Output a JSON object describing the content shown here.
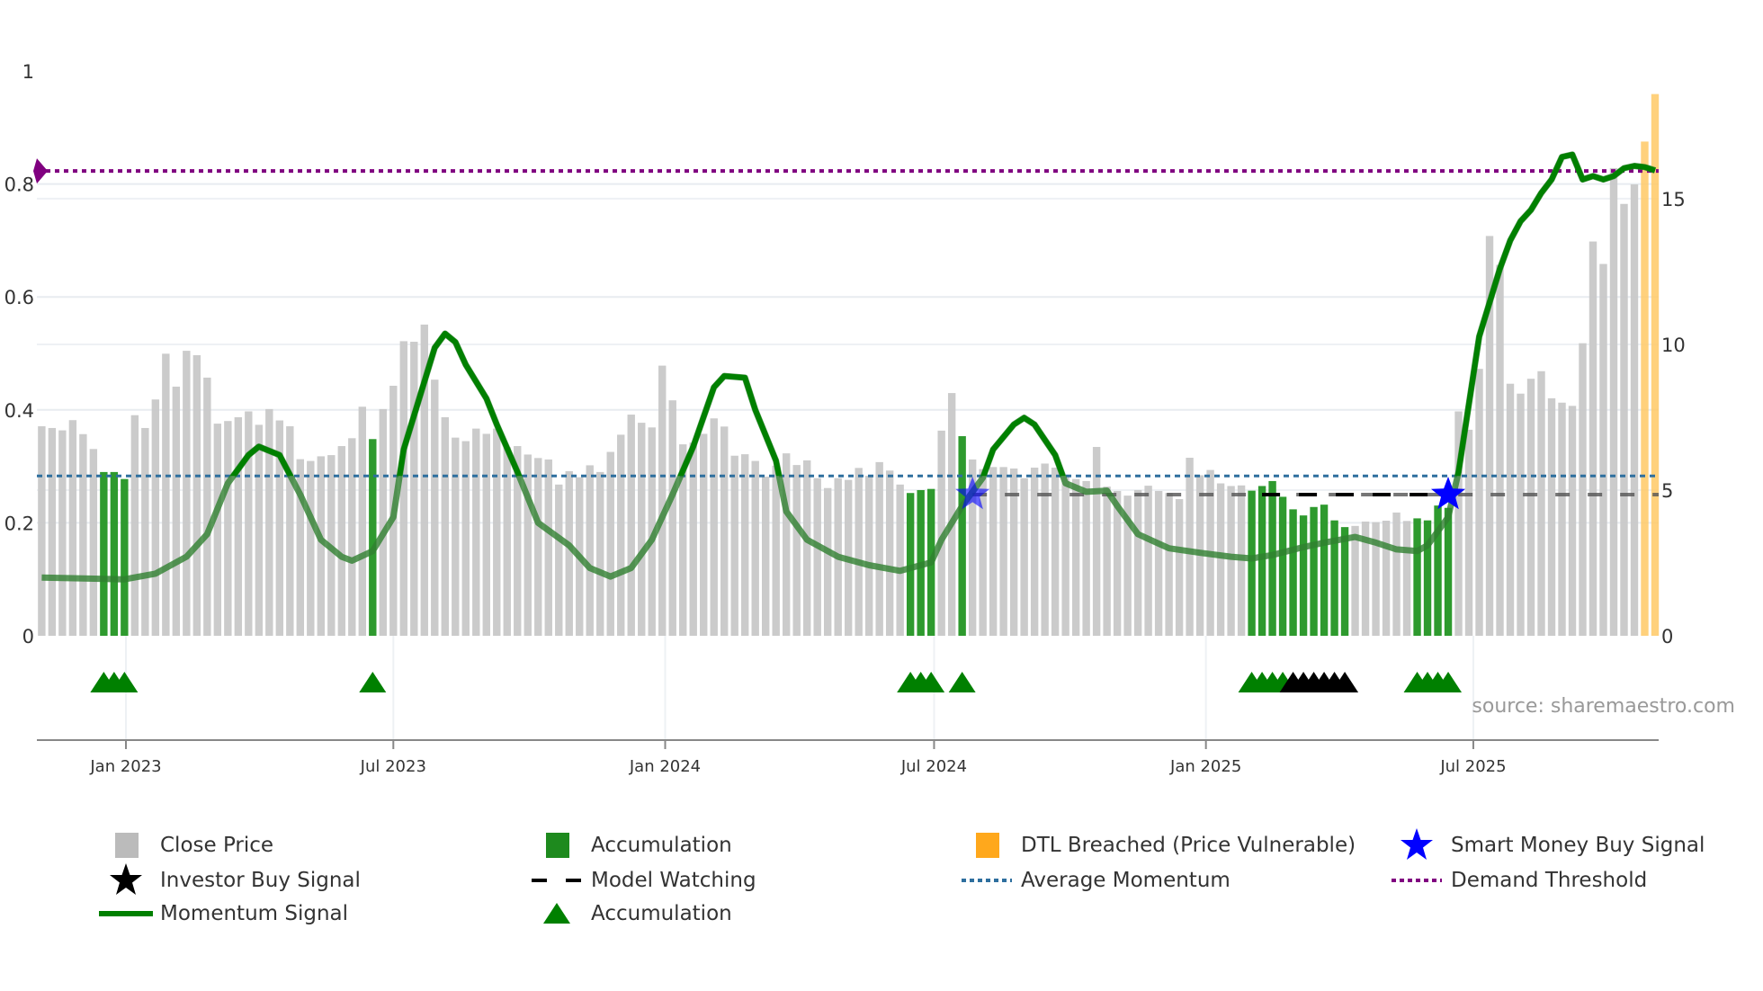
{
  "chart_data": {
    "type": "bar",
    "title": "",
    "source": "source: sharemaestro.com",
    "x_interval": "weekly",
    "start_date": "2022-11-05",
    "x_ticks": [
      {
        "date": "2023-01-01",
        "label": "Jan 2023"
      },
      {
        "date": "2023-07-01",
        "label": "Jul 2023"
      },
      {
        "date": "2024-01-01",
        "label": "Jan 2024"
      },
      {
        "date": "2024-07-01",
        "label": "Jul 2024"
      },
      {
        "date": "2025-01-01",
        "label": "Jan 2025"
      },
      {
        "date": "2025-07-01",
        "label": "Jul 2025"
      }
    ],
    "y_left": {
      "range": [
        0,
        1
      ],
      "ticks": [
        "0",
        "0.2",
        "0.4",
        "0.6",
        "0.8",
        "1"
      ],
      "tick_values": [
        0,
        0.2,
        0.4,
        0.6,
        0.8,
        1
      ]
    },
    "y_right": {
      "range": [
        0,
        19.38
      ],
      "ticks": [
        "0",
        "5",
        "10",
        "15"
      ],
      "tick_values": [
        0,
        5,
        10,
        15
      ]
    },
    "grid": true,
    "legend_position": "bottom",
    "close_price": [
      7.19,
      7.13,
      7.05,
      7.4,
      6.92,
      6.41,
      5.62,
      5.62,
      5.38,
      7.57,
      7.13,
      8.11,
      9.68,
      8.55,
      9.78,
      9.63,
      8.86,
      7.28,
      7.37,
      7.5,
      7.7,
      7.24,
      7.78,
      7.39,
      7.19,
      6.06,
      6.0,
      6.16,
      6.2,
      6.51,
      6.78,
      7.86,
      6.75,
      7.78,
      8.58,
      10.11,
      10.09,
      10.68,
      8.79,
      7.5,
      6.8,
      6.68,
      7.11,
      6.93,
      7.11,
      6.47,
      6.51,
      6.22,
      6.1,
      6.05,
      5.19,
      5.65,
      5.44,
      5.85,
      5.62,
      6.31,
      6.9,
      7.59,
      7.31,
      7.15,
      9.27,
      8.08,
      6.57,
      6.63,
      6.93,
      7.46,
      7.18,
      6.18,
      6.23,
      6.0,
      5.46,
      5.84,
      6.26,
      5.86,
      6.02,
      5.41,
      5.07,
      5.41,
      5.35,
      5.76,
      5.49,
      5.96,
      5.67,
      5.19,
      4.9,
      5.0,
      5.04,
      7.04,
      8.33,
      6.85,
      6.05,
      5.72,
      5.79,
      5.79,
      5.74,
      5.41,
      5.77,
      5.91,
      5.77,
      5.46,
      5.38,
      5.31,
      6.48,
      5.12,
      4.97,
      4.81,
      5.0,
      5.15,
      4.97,
      4.9,
      4.69,
      6.11,
      5.51,
      5.69,
      5.23,
      5.14,
      5.16,
      4.98,
      5.14,
      5.31,
      4.77,
      4.34,
      4.13,
      4.42,
      4.5,
      3.96,
      3.73,
      3.77,
      3.92,
      3.9,
      3.95,
      4.23,
      3.94,
      4.03,
      3.96,
      4.47,
      4.39,
      7.7,
      7.07,
      9.16,
      13.72,
      12.73,
      8.65,
      8.31,
      8.82,
      9.08,
      8.15,
      8.0,
      7.89,
      10.04,
      13.53,
      12.76,
      16.05,
      14.82,
      15.49,
      16.96,
      18.59
    ],
    "accumulation_weeks": [
      6,
      7,
      8,
      32,
      84,
      85,
      86,
      89,
      117,
      118,
      119,
      120,
      121,
      122,
      123,
      124,
      125,
      126,
      133,
      134,
      135,
      136
    ],
    "dtl_breached_weeks": [
      155,
      156
    ],
    "accumulation_marker_weeks": [
      6,
      7,
      8,
      32,
      84,
      85,
      86,
      89,
      117,
      118,
      119,
      120,
      133,
      134,
      135,
      136
    ],
    "investor_buy_marker_weeks": [
      121,
      122,
      123,
      124,
      125,
      126
    ],
    "smart_money_buy_signals": [
      {
        "week": 90,
        "value": 0.25,
        "faded": true
      },
      {
        "week": 136,
        "value": 0.25,
        "faded": false
      }
    ],
    "momentum_signal": {
      "weeks": [
        0,
        8,
        11,
        14,
        16,
        18,
        20,
        21,
        23,
        25,
        27,
        29,
        30,
        32,
        34,
        35,
        37,
        38,
        39,
        40,
        41,
        43,
        44,
        46,
        48,
        51,
        53,
        55,
        57,
        59,
        61,
        63,
        65,
        66,
        68,
        69,
        71,
        72,
        74,
        77,
        80,
        83,
        86,
        87,
        89,
        91,
        92,
        94,
        95,
        96,
        98,
        99,
        101,
        103,
        104,
        106,
        109,
        112,
        115,
        117,
        119,
        122,
        124,
        127,
        129,
        131,
        133,
        134,
        136,
        137,
        138,
        139,
        141,
        142,
        143,
        144,
        145,
        146,
        147,
        148,
        149,
        150,
        151,
        152,
        153,
        154,
        155,
        156
      ],
      "values": [
        0.103,
        0.1,
        0.11,
        0.14,
        0.18,
        0.27,
        0.32,
        0.335,
        0.32,
        0.25,
        0.17,
        0.14,
        0.133,
        0.15,
        0.21,
        0.33,
        0.45,
        0.51,
        0.535,
        0.52,
        0.48,
        0.42,
        0.374,
        0.29,
        0.2,
        0.16,
        0.12,
        0.105,
        0.12,
        0.17,
        0.25,
        0.335,
        0.44,
        0.46,
        0.457,
        0.4,
        0.31,
        0.22,
        0.17,
        0.14,
        0.125,
        0.115,
        0.13,
        0.17,
        0.23,
        0.28,
        0.33,
        0.374,
        0.386,
        0.374,
        0.32,
        0.27,
        0.255,
        0.257,
        0.23,
        0.18,
        0.155,
        0.147,
        0.14,
        0.137,
        0.143,
        0.157,
        0.165,
        0.175,
        0.165,
        0.153,
        0.15,
        0.16,
        0.21,
        0.29,
        0.41,
        0.53,
        0.65,
        0.7,
        0.734,
        0.754,
        0.784,
        0.808,
        0.848,
        0.852,
        0.808,
        0.814,
        0.808,
        0.814,
        0.828,
        0.832,
        0.83,
        0.824
      ]
    },
    "average_momentum": 0.283,
    "demand_threshold": 0.823,
    "model_watching": {
      "value": 0.25,
      "start_week": 90,
      "end_week": 156,
      "active_start_week": 118,
      "active_end_week": 136
    },
    "colors": {
      "close": "#c8c8c8",
      "accumulation": "#2e9a2e",
      "dtl": "#ffc965",
      "momentum": "#008000",
      "avg_momentum": "#2e6f9e",
      "demand": "#800080",
      "smart_money": "#0000ff",
      "investor": "#000000"
    },
    "legend": [
      {
        "label": "Close Price",
        "icon": "gray-square"
      },
      {
        "label": "Accumulation",
        "icon": "green-square"
      },
      {
        "label": "DTL Breached (Price Vulnerable)",
        "icon": "orange-square"
      },
      {
        "label": "Smart Money Buy Signal",
        "icon": "blue-star"
      },
      {
        "label": "Investor Buy Signal",
        "icon": "black-star"
      },
      {
        "label": "Model Watching",
        "icon": "black-dashed-line"
      },
      {
        "label": "Average Momentum",
        "icon": "blue-dotted-line"
      },
      {
        "label": "Demand Threshold",
        "icon": "purple-dotted-line"
      },
      {
        "label": "Momentum Signal",
        "icon": "green-line"
      },
      {
        "label": "Accumulation",
        "icon": "green-triangle"
      }
    ]
  }
}
